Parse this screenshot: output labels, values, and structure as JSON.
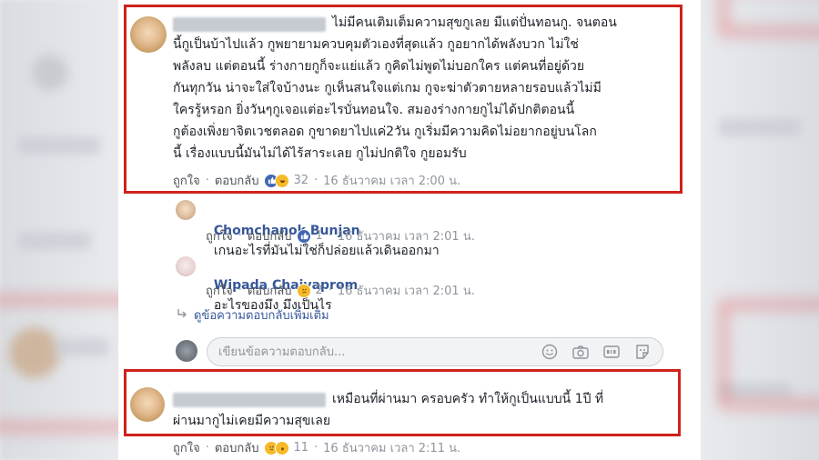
{
  "comments": [
    {
      "text_lines": [
        "ไม่มีคนเติมเต็มความสุขกูเลย มีแต่ปั่นทอนกู. จนตอน",
        "นี้กูเป็นบ้าไปแล้ว กูพยายามควบคุมตัวเองที่สุดแล้ว กูอยากได้พลังบวก ไม่ใช่",
        "พลังลบ แต่ตอนนี้ ร่างกายกูก็จะแย่แล้ว กูคิดไม่พูดไม่บอกใคร แต่คนที่อยู่ด้วย",
        "กันทุกวัน น่าจะใส่ใจบ้างนะ กูเห็นสนใจแต่เกม กูจะฆ่าตัวตายหลายรอบแล้วไม่มี",
        "ใครรู้หรอก ยิ่งวันๆกูเจอแต่อะไรบั่นทอนใจ. สมองร่างกายกูไม่ได้ปกติตอนนี้",
        "กูต้องเพิ่งยาจิตเวชตลอด กูขาดยาไปแค่2วัน กูเริ่มมีความคิดไม่อยากอยู่บนโลก",
        "นี้ เรื่องแบบนี้มันไม่ได้ไร้สาระเลย กูไม่ปกติใจ กูยอมรับ"
      ],
      "like_label": "ถูกใจ",
      "reply_label": "ตอบกลับ",
      "reaction_count": "32",
      "timestamp": "16 ธันวาคม เวลา 2:00 น."
    },
    {
      "author": "Chomchanok Bunjan",
      "text": "เกนอะไรที่มันไม่ใช่ก็ปล่อยแล้วเดินออกมา",
      "like_label": "ถูกใจ",
      "reply_label": "ตอบกลับ",
      "reaction_count": "1",
      "timestamp": "16 ธันวาคม เวลา 2:01 น."
    },
    {
      "author": "Wipada Chaiyaprom",
      "text": "อะไรของมึง มึงเป็นไร",
      "like_label": "ถูกใจ",
      "reply_label": "ตอบกลับ",
      "reaction_count": "2",
      "timestamp": "16 ธันวาคม เวลา 2:01 น."
    },
    {
      "text_lines": [
        "เหมือนที่ผ่านมา ครอบครัว ทำให้กูเป็นแบบนี้ 1ปี ที่",
        "ผ่านมากูไม่เคยมีความสุขเลย"
      ],
      "like_label": "ถูกใจ",
      "reply_label": "ตอบกลับ",
      "reaction_count": "11",
      "timestamp": "16 ธันวาคม เวลา 2:11 น."
    }
  ],
  "more_replies_label": "ดูข้อความตอบกลับเพิ่มเติม",
  "reply_input": {
    "placeholder": "เขียนข้อความตอบกลับ..."
  },
  "icons": [
    "like-icon",
    "haha-icon",
    "sad-icon",
    "wow-icon",
    "reply-arrow-icon",
    "emoji-icon",
    "camera-icon",
    "gif-icon",
    "sticker-icon"
  ],
  "colors": {
    "highlight_border": "#d0211b",
    "link": "#365899",
    "meta": "#90949c",
    "like_blue": "#4267b2"
  }
}
